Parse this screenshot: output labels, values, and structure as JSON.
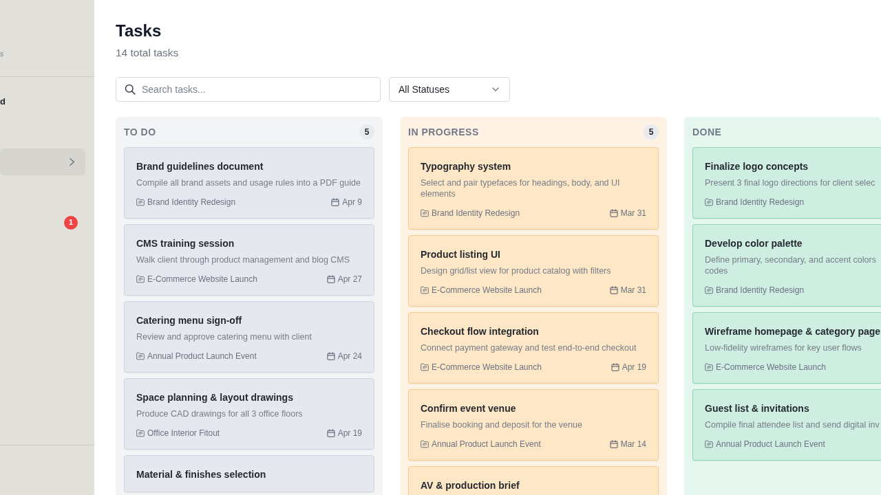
{
  "sidebar": {
    "caption": "s",
    "heading": "d",
    "items": [
      {
        "selected": true,
        "has_submenu": true
      },
      {
        "selected": false,
        "badge": "1"
      }
    ]
  },
  "header": {
    "title": "Tasks",
    "subtitle": "14 total tasks"
  },
  "filters": {
    "search": {
      "placeholder": "Search tasks..."
    },
    "status_select": {
      "value": "All Statuses"
    }
  },
  "columns": [
    {
      "kind": "todo",
      "title": "TO DO",
      "count": "5",
      "cards": [
        {
          "title": "Brand guidelines document",
          "description": "Compile all brand assets and usage rules into a PDF guide",
          "project": "Brand Identity Redesign",
          "due": "Apr 9"
        },
        {
          "title": "CMS training session",
          "description": "Walk client through product management and blog CMS",
          "project": "E-Commerce Website Launch",
          "due": "Apr 27"
        },
        {
          "title": "Catering menu sign-off",
          "description": "Review and approve catering menu with client",
          "project": "Annual Product Launch Event",
          "due": "Apr 24"
        },
        {
          "title": "Space planning & layout drawings",
          "description": "Produce CAD drawings for all 3 office floors",
          "project": "Office Interior Fitout",
          "due": "Apr 19"
        },
        {
          "title": "Material & finishes selection"
        }
      ]
    },
    {
      "kind": "in_progress",
      "title": "IN PROGRESS",
      "count": "5",
      "cards": [
        {
          "title": "Typography system",
          "description": "Select and pair typefaces for headings, body, and UI elements",
          "project": "Brand Identity Redesign",
          "due": "Mar 31"
        },
        {
          "title": "Product listing UI",
          "description": "Design grid/list view for product catalog with filters",
          "project": "E-Commerce Website Launch",
          "due": "Mar 31"
        },
        {
          "title": "Checkout flow integration",
          "description": "Connect payment gateway and test end-to-end checkout",
          "project": "E-Commerce Website Launch",
          "due": "Apr 19"
        },
        {
          "title": "Confirm event venue",
          "description": "Finalise booking and deposit for the venue",
          "project": "Annual Product Launch Event",
          "due": "Mar 14"
        },
        {
          "title": "AV & production brief"
        }
      ]
    },
    {
      "kind": "done",
      "title": "DONE",
      "cards": [
        {
          "title": "Finalize logo concepts",
          "description": "Present 3 final logo directions for client selec",
          "project": "Brand Identity Redesign"
        },
        {
          "title": "Develop color palette",
          "description": "Define primary, secondary, and accent colors\ncodes",
          "project": "Brand Identity Redesign"
        },
        {
          "title": "Wireframe homepage & category page",
          "description": "Low-fidelity wireframes for key user flows",
          "project": "E-Commerce Website Launch"
        },
        {
          "title": "Guest list & invitations",
          "description": "Compile final attendee list and send digital inv",
          "project": "Annual Product Launch Event"
        }
      ]
    }
  ]
}
